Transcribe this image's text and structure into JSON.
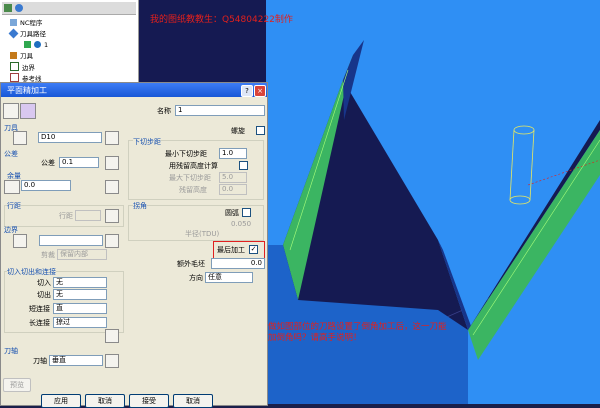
{
  "watermark": "我的图纸教教生：Q54804222制作",
  "note": "做如图部位的刀路设置了倒角加工后，这一刀能加倒角吗？请高手说明！",
  "explorer": {
    "items": [
      {
        "label": "NC程序"
      },
      {
        "label": "刀具路径"
      },
      {
        "label": "1"
      },
      {
        "label": "刀具"
      },
      {
        "label": "边界"
      },
      {
        "label": "参考线"
      }
    ]
  },
  "dialog": {
    "title": "平面精加工",
    "help_label": "?",
    "close_label": "×",
    "name_label": "名称",
    "name_value": "1",
    "tool_section": "刀具",
    "tool_value": "D10",
    "tolerance_section": "公差",
    "tolerance_label": "公差",
    "tolerance_value": "0.1",
    "allowance_section": "余量",
    "allowance_value": "0.0",
    "stepover_section": "行距",
    "stepover_label": "行距",
    "boundary_section": "边界",
    "boundary_option_label": "剪裁",
    "boundary_option_value": "保留内部",
    "leads_section": "切入切出和连接",
    "lead_in_label": "切入",
    "lead_in_value": "无",
    "lead_out_label": "切出",
    "lead_out_value": "无",
    "short_link_label": "短连接",
    "short_link_value": "直",
    "long_link_label": "长连接",
    "long_link_value": "掠过",
    "tool_axis_section": "刀轴",
    "tool_axis_label": "刀轴",
    "tool_axis_value": "垂直",
    "preview_label": "预览",
    "spiral_label": "螺旋",
    "downstep_section": "下切步距",
    "min_downstep_label": "最小下切步距",
    "min_downstep_value": "1.0",
    "use_residual_label": "用残留高度计算",
    "max_downstep_label": "最大下切步距",
    "max_downstep_value": "5.0",
    "residual_height_label": "残留高度",
    "residual_height_value": "0.0",
    "corner_section": "拐角",
    "arc_label": "圆弧",
    "radius_value": "0.050",
    "radius_label": "半径(TDU)",
    "last_pass_label": "最后加工",
    "last_pass_checked": "✓",
    "extra_stock_label": "额外毛坯",
    "extra_stock_value": "0.0",
    "direction_label": "方向",
    "direction_value": "任意",
    "buttons": [
      "应用",
      "取消",
      "接受",
      "取消"
    ]
  }
}
